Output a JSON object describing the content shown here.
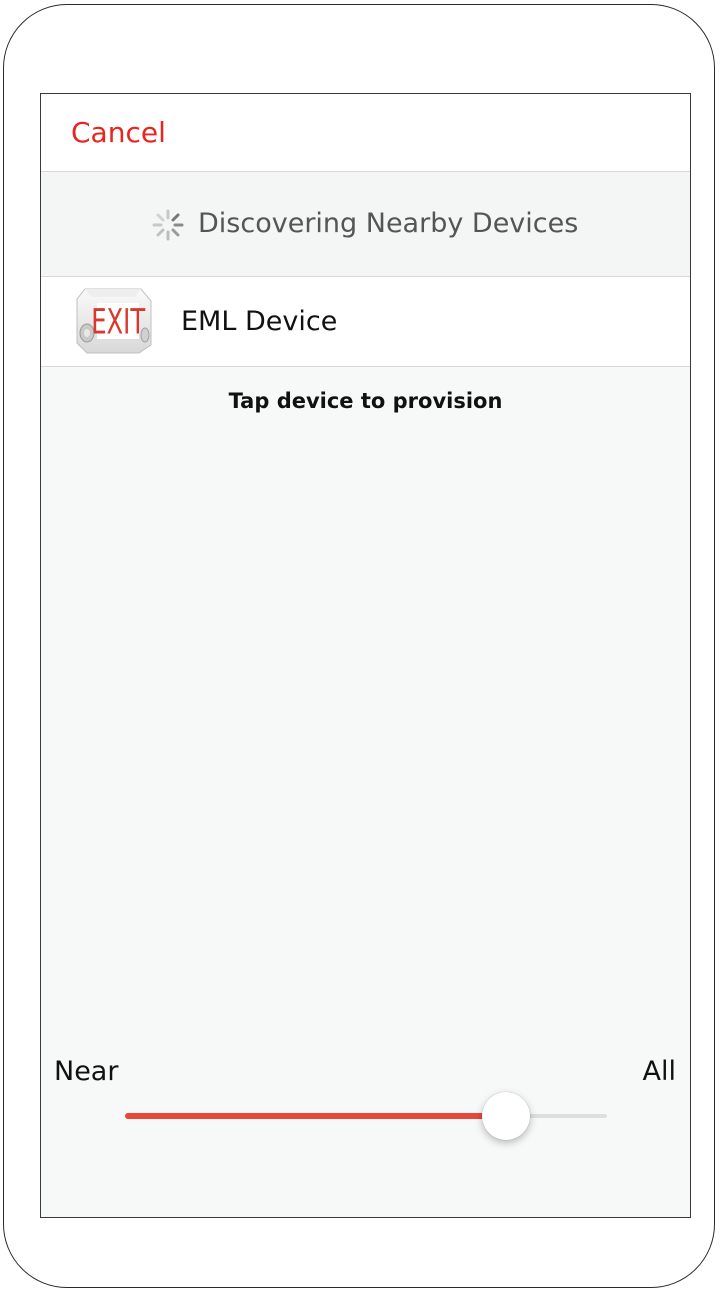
{
  "nav": {
    "cancel_label": "Cancel"
  },
  "discovery": {
    "status_text": "Discovering Nearby Devices",
    "icon": "activity-spinner-icon"
  },
  "devices": [
    {
      "name": "EML Device",
      "thumbnail_text": "EXIT",
      "icon": "exit-sign-icon"
    }
  ],
  "hint": "Tap device to provision",
  "range_slider": {
    "min_label": "Near",
    "max_label": "All",
    "value_fraction": 0.79
  },
  "colors": {
    "accent": "#e8261f",
    "slider_fill": "#e8473c",
    "background": "#f7f8f8"
  }
}
